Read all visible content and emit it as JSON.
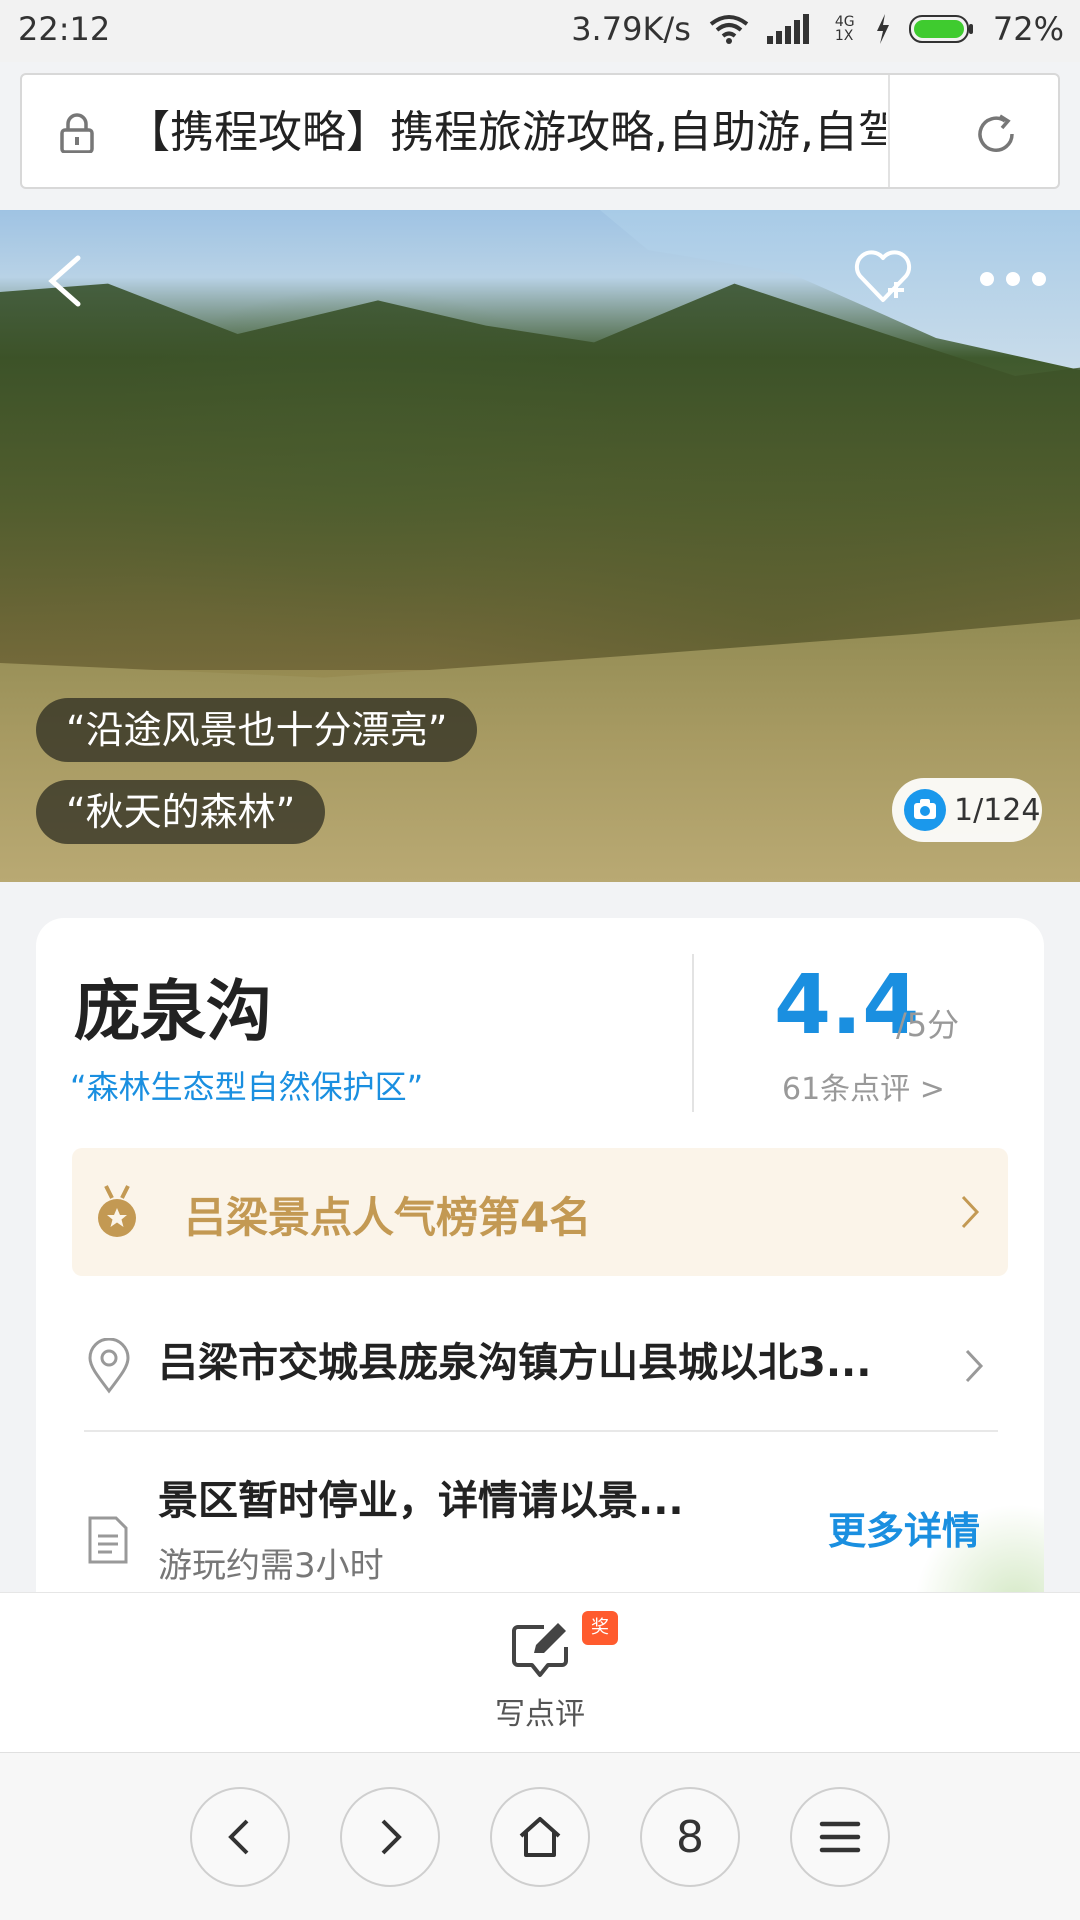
{
  "status_bar": {
    "time": "22:12",
    "speed": "3.79K/s",
    "network": "4G 1X",
    "battery": "72%"
  },
  "url_bar": {
    "text": "【携程攻略】携程旅游攻略,自助游,自驾"
  },
  "hero": {
    "quotes": [
      "“沿途风景也十分漂亮”",
      "“秋天的森林”"
    ],
    "photo_count": "1/124"
  },
  "card": {
    "title": "庞泉沟",
    "subtitle": "“森林生态型自然保护区”",
    "score": "4.4",
    "score_unit": "/5分",
    "reviews": "61条点评 >",
    "rank": "吕梁景点人气榜第4名",
    "address": "吕梁市交城县庞泉沟镇方山县城以北3...",
    "status": "景区暂时停业，详情请以景...",
    "duration": "游玩约需3小时",
    "more": "更多详情"
  },
  "review_bar": {
    "badge": "奖",
    "label": "写点评"
  },
  "browser_nav": {
    "tabs_count": "8"
  },
  "colors": {
    "accent": "#1a8fe0",
    "rank_gold": "#c39953",
    "badge_red": "#ff5b2e"
  }
}
